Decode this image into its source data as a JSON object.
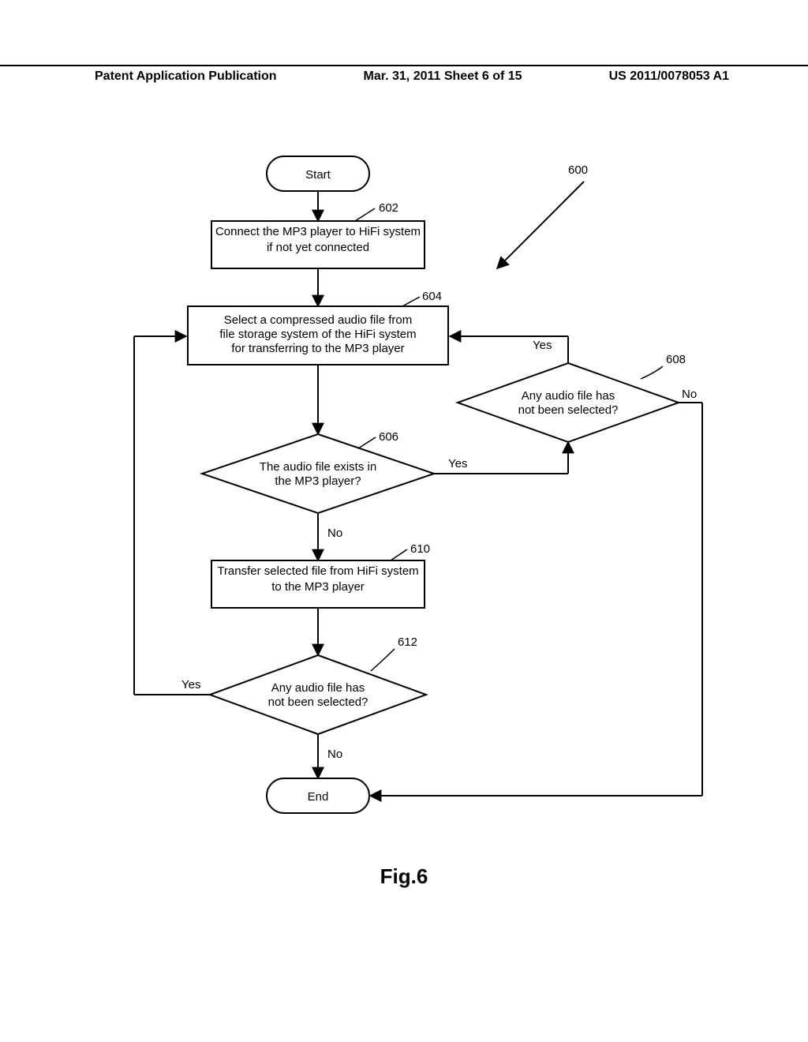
{
  "header": {
    "left": "Patent Application Publication",
    "middle": "Mar. 31, 2011  Sheet 6 of 15",
    "right": "US 2011/0078053 A1"
  },
  "refs": {
    "diagram": "600",
    "r602": "602",
    "r604": "604",
    "r606": "606",
    "r608": "608",
    "r610": "610",
    "r612": "612"
  },
  "nodes": {
    "start": "Start",
    "end": "End",
    "n602": "Connect the MP3 player to HiFi system if not yet connected",
    "n604_l1": "Select a compressed audio file from",
    "n604_l2": "file storage system of the HiFi system",
    "n604_l3": "for transferring to the MP3 player",
    "n606_l1": "The audio file exists in",
    "n606_l2": "the MP3 player?",
    "n608_l1": "Any audio file has",
    "n608_l2": "not been selected?",
    "n610": "Transfer selected file from HiFi system to the MP3 player",
    "n612_l1": "Any audio file has",
    "n612_l2": "not been selected?"
  },
  "labels": {
    "yes": "Yes",
    "no": "No"
  },
  "figure": "Fig.6"
}
